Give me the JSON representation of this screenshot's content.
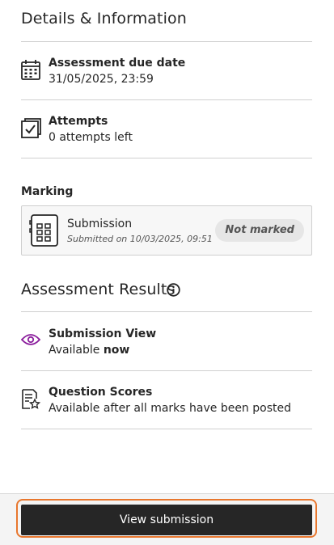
{
  "details": {
    "heading": "Details & Information",
    "due": {
      "title": "Assessment due date",
      "value": "31/05/2025, 23:59",
      "icon": "calendar-icon"
    },
    "attempts": {
      "title": "Attempts",
      "value": "0 attempts left",
      "icon": "attempts-icon"
    }
  },
  "marking": {
    "label": "Marking",
    "submission": {
      "title": "Submission",
      "submitted": "Submitted on 10/03/2025, 09:51",
      "status": "Not marked",
      "icon": "document-grid-icon"
    }
  },
  "results": {
    "heading": "Assessment Results",
    "info_icon": "info-icon",
    "submission_view": {
      "title": "Submission View",
      "value_prefix": "Available",
      "value_strong": "now",
      "icon": "eye-icon"
    },
    "question_scores": {
      "title": "Question Scores",
      "value": "Available after all marks have been posted",
      "icon": "document-star-icon"
    }
  },
  "footer": {
    "button_label": "View submission"
  },
  "colors": {
    "accent_purple": "#8a1c9c",
    "focus_orange": "#e8772e",
    "button_dark": "#262626"
  }
}
